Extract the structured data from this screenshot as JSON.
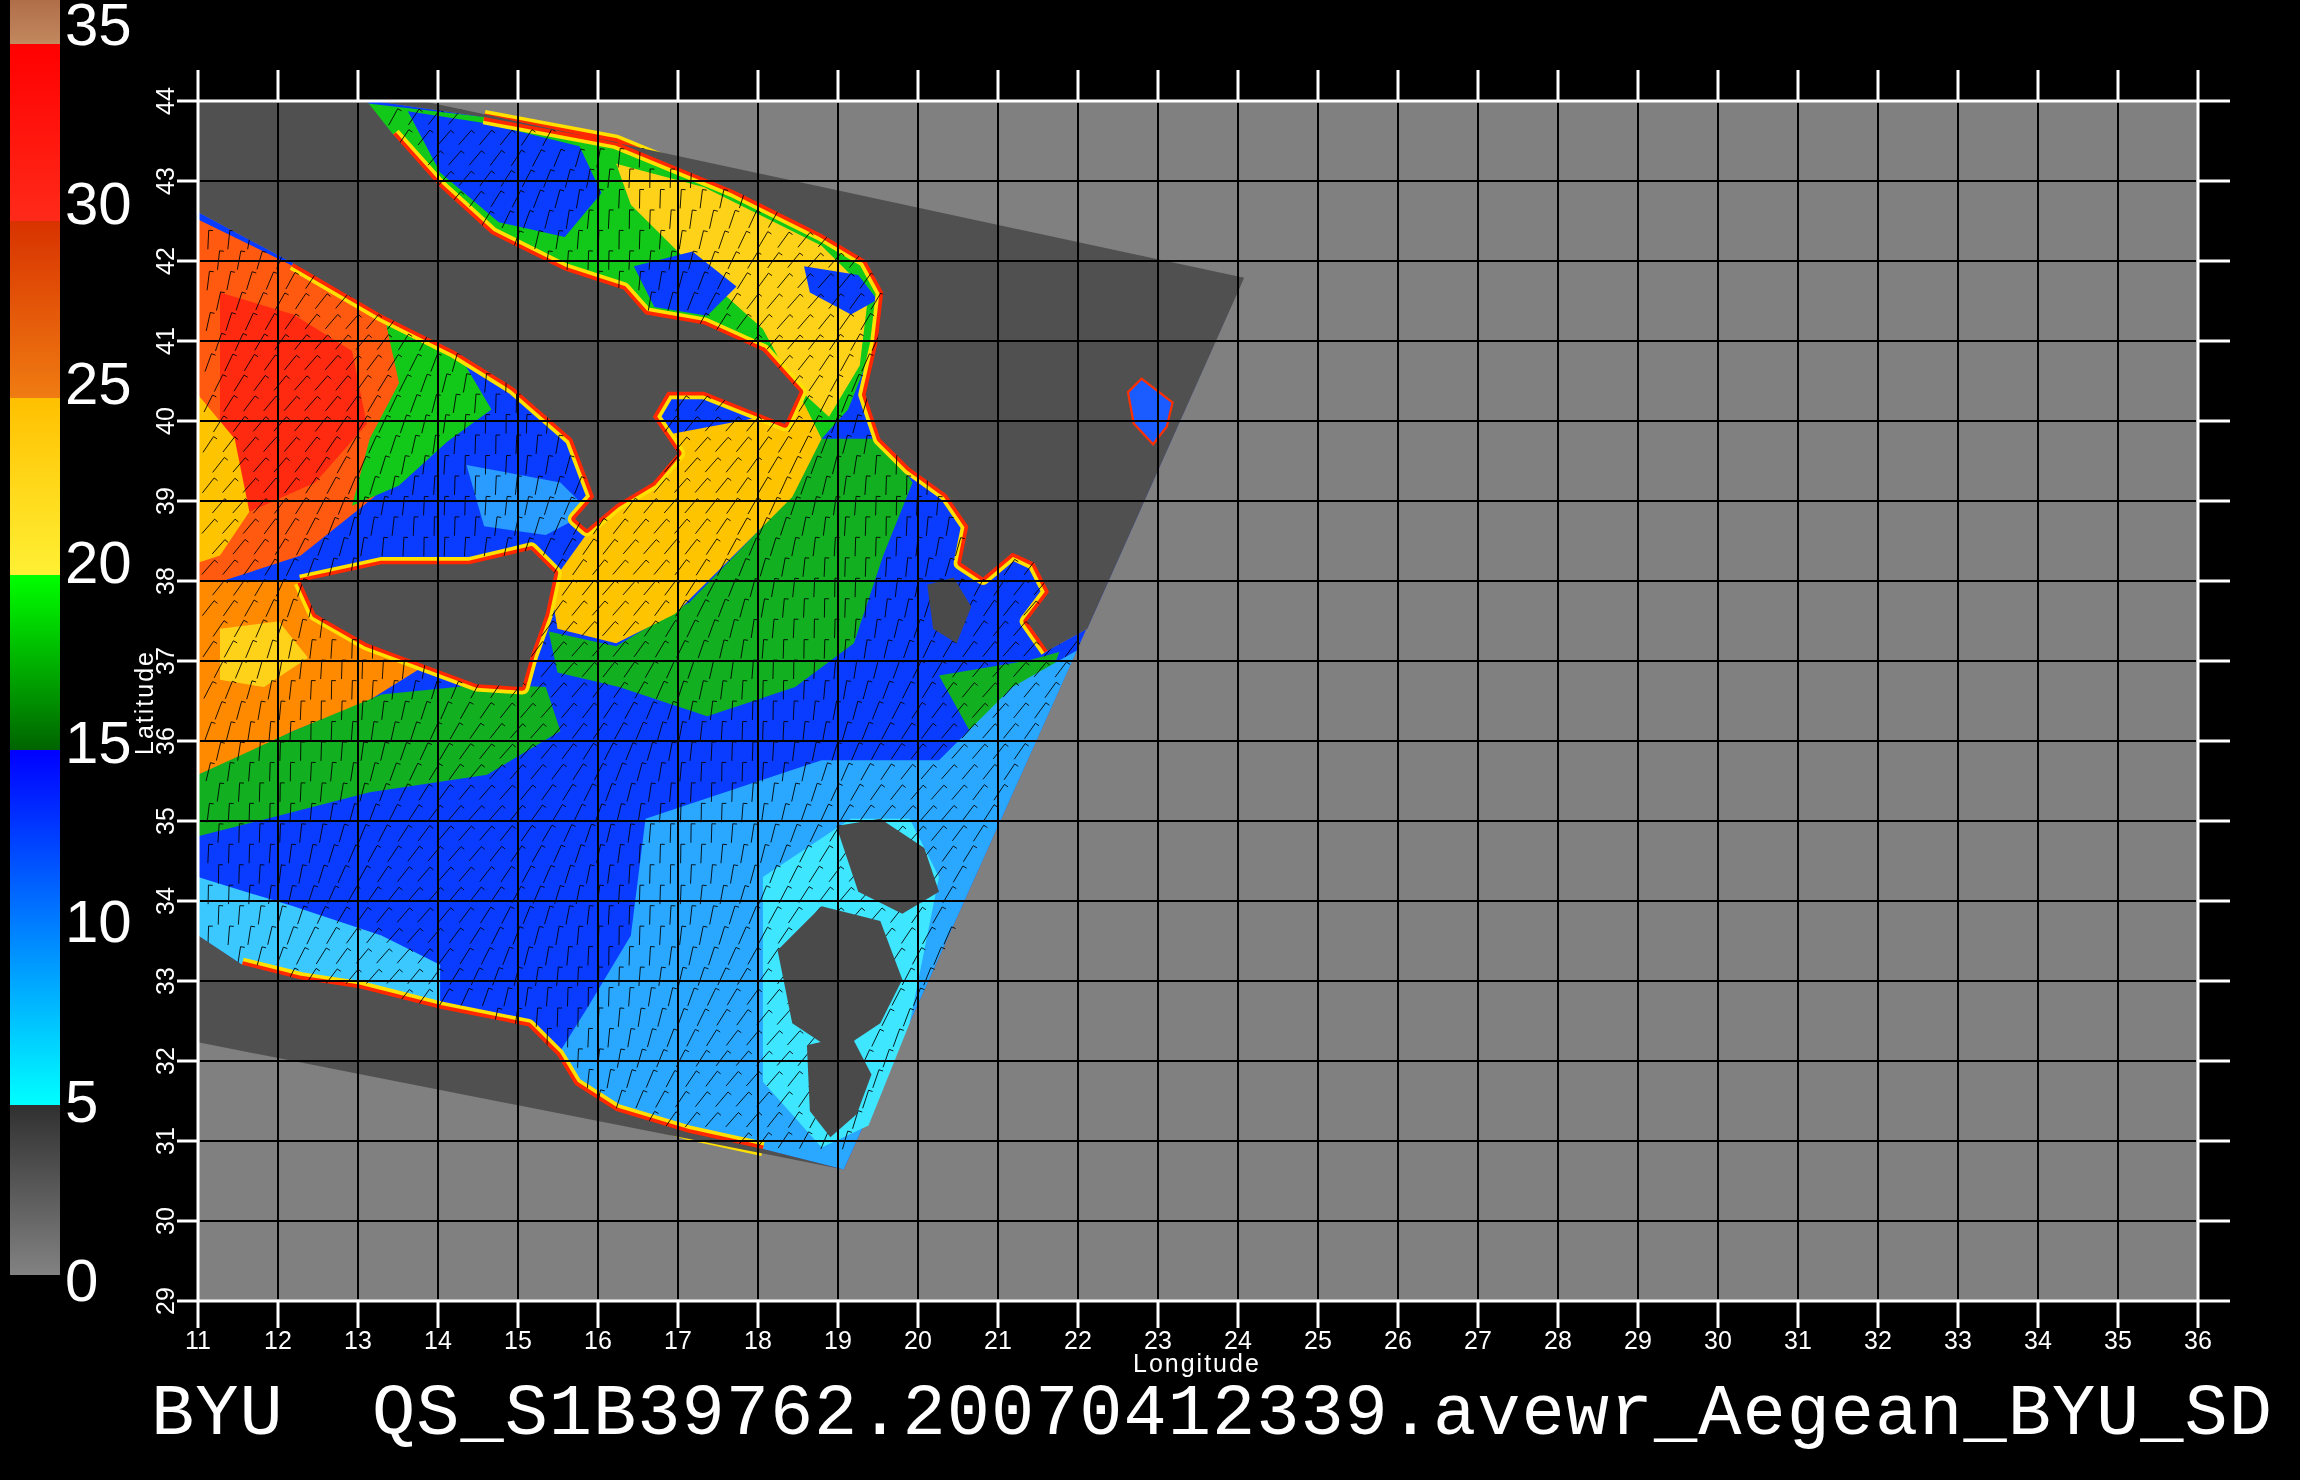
{
  "color_scale": {
    "labels": [
      "35",
      "30",
      "25",
      "20",
      "15",
      "10",
      "5",
      "0"
    ]
  },
  "map": {
    "y_axis": {
      "title": "Latitude",
      "ticks": [
        "44",
        "43",
        "42",
        "41",
        "40",
        "39",
        "38",
        "37",
        "36",
        "35",
        "34",
        "33",
        "32",
        "31",
        "30",
        "29"
      ]
    },
    "x_axis": {
      "ticks": [
        "11",
        "12",
        "13",
        "14",
        "15",
        "16",
        "17",
        "18",
        "19",
        "20",
        "21",
        "22",
        "23",
        "24",
        "25",
        "26",
        "27",
        "28",
        "29",
        "30",
        "31",
        "32",
        "33",
        "34",
        "35",
        "36"
      ],
      "title": "Longitude"
    }
  },
  "title": "BYU  QS_S1B39762.20070412339.avewr_Aegean_BYU_SD"
}
